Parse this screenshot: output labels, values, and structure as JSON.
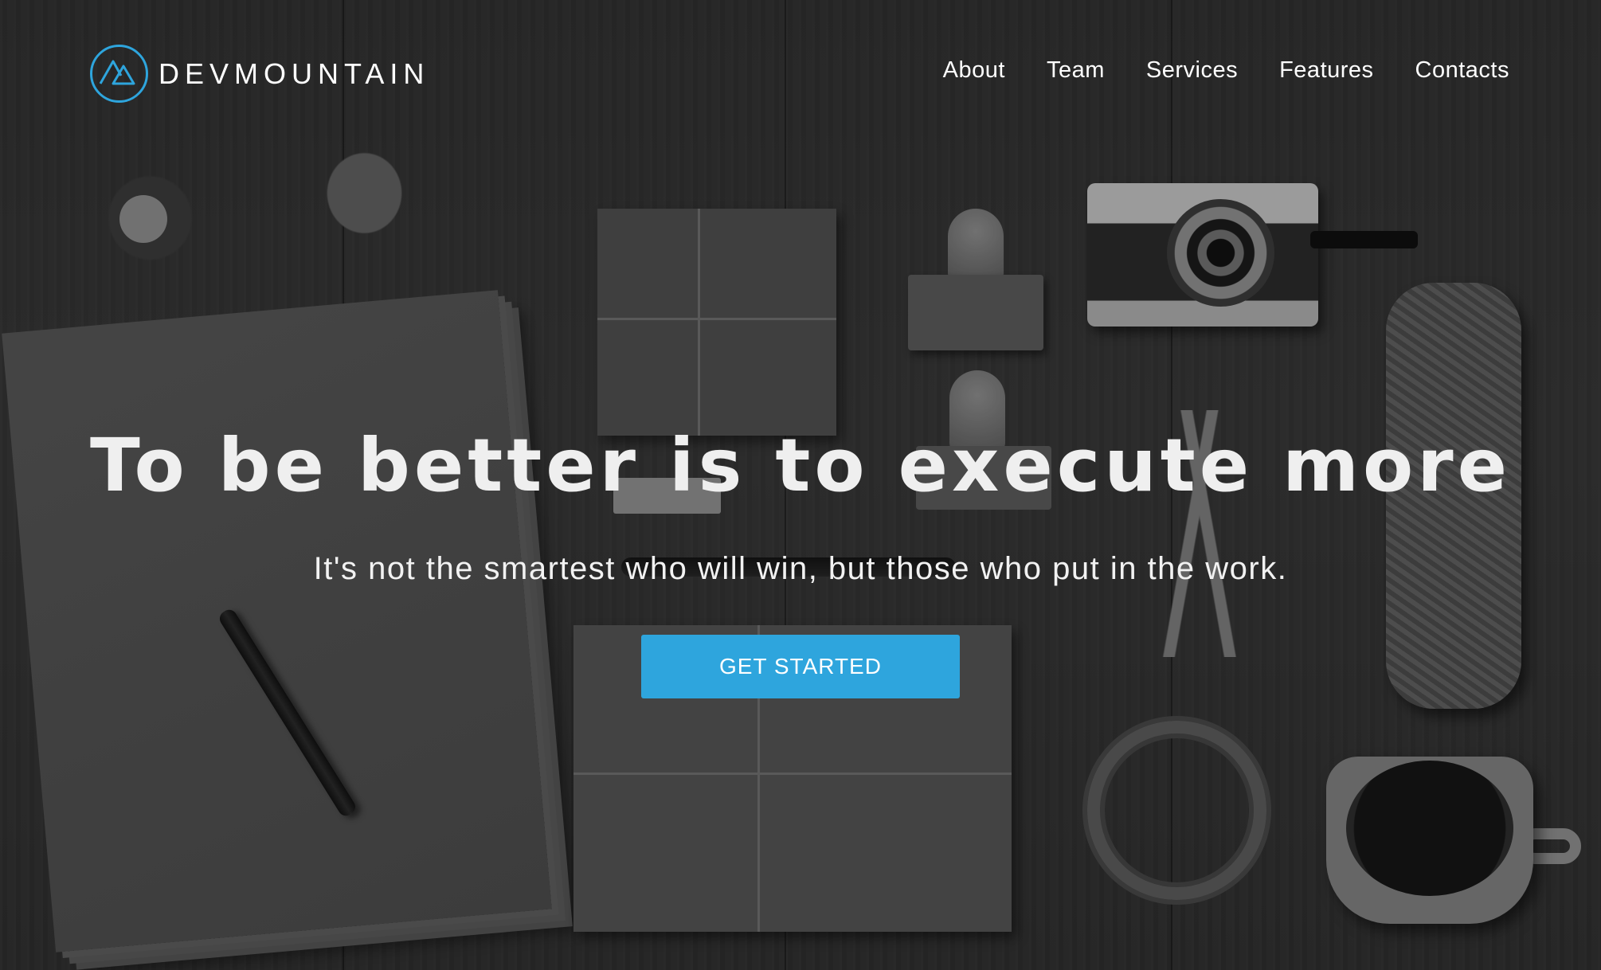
{
  "brand": {
    "name": "DEVMOUNTAIN",
    "logo_icon": "mountain-logo-icon",
    "accent_color": "#2ea5dd"
  },
  "nav": {
    "items": [
      {
        "label": "About"
      },
      {
        "label": "Team"
      },
      {
        "label": "Services"
      },
      {
        "label": "Features"
      },
      {
        "label": "Contacts"
      }
    ]
  },
  "hero": {
    "headline": "To be better is to execute more",
    "subheadline": "It's not the smartest who will win, but those who put in the work.",
    "cta_label": "GET STARTED",
    "cta_color": "#2ea5dd"
  }
}
